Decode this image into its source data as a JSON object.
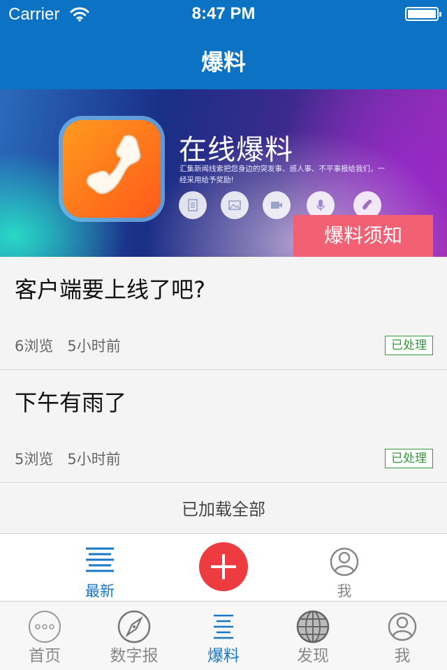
{
  "status_bar": {
    "carrier": "Carrier",
    "time": "8:47 PM"
  },
  "nav": {
    "title": "爆料"
  },
  "banner": {
    "title": "在线爆料",
    "subtitle": "汇集新闻线索把您身边的突发事、感人事、不平事报给我们，一经采用给予奖励!",
    "icons": [
      "document-icon",
      "image-icon",
      "video-icon",
      "microphone-icon",
      "phone-icon"
    ],
    "notice_label": "爆料须知"
  },
  "items": [
    {
      "title": "客户端要上线了吧?",
      "views": "6浏览",
      "time": "5小时前",
      "status": "已处理"
    },
    {
      "title": "下午有雨了",
      "views": "5浏览",
      "time": "5小时前",
      "status": "已处理"
    }
  ],
  "list_footer": "已加载全部",
  "sub_toolbar": {
    "latest_label": "最新",
    "me_label": "我",
    "add_icon": "plus-icon"
  },
  "tab_bar": {
    "items": [
      {
        "label": "首页",
        "icon": "home-dots-icon"
      },
      {
        "label": "数字报",
        "icon": "compass-icon"
      },
      {
        "label": "爆料",
        "icon": "list-lines-icon"
      },
      {
        "label": "发现",
        "icon": "globe-icon"
      },
      {
        "label": "我",
        "icon": "user-icon"
      }
    ],
    "active": "爆料"
  },
  "colors": {
    "nav_blue": "#0b72c4",
    "notice_pink": "#f26173",
    "add_red": "#ee3b3f",
    "processed_green": "#2f9a3a",
    "active_tab": "#1777c4"
  }
}
